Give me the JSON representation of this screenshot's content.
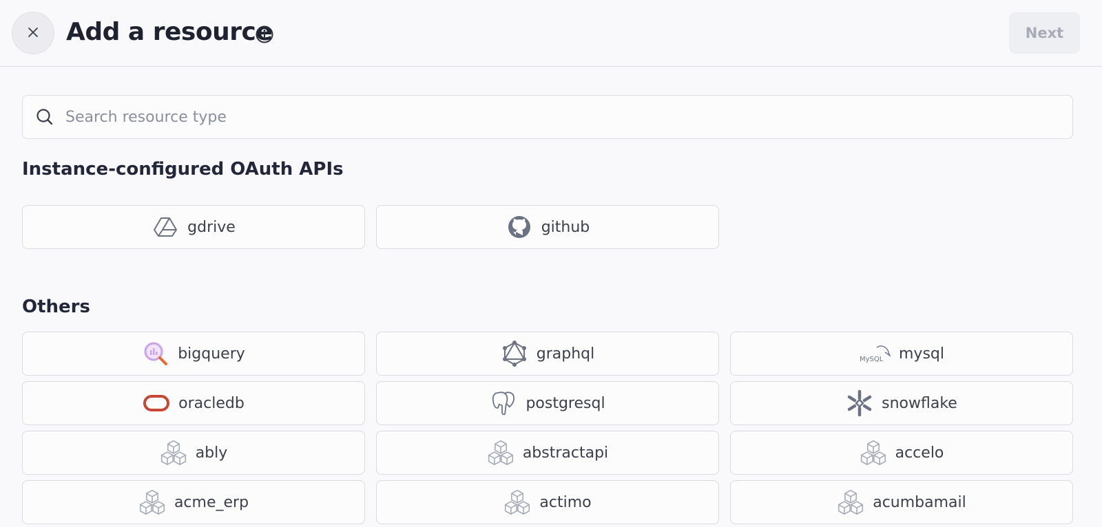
{
  "header": {
    "title": "Add a resource",
    "next_label": "Next"
  },
  "search": {
    "placeholder": "Search resource type",
    "value": ""
  },
  "sections": {
    "oauth": {
      "title": "Instance-configured OAuth APIs",
      "items": [
        {
          "label": "gdrive",
          "icon": "google-drive-icon"
        },
        {
          "label": "github",
          "icon": "github-icon"
        }
      ]
    },
    "others": {
      "title": "Others",
      "items": [
        {
          "label": "bigquery",
          "icon": "bigquery-icon"
        },
        {
          "label": "graphql",
          "icon": "graphql-icon"
        },
        {
          "label": "mysql",
          "icon": "mysql-icon"
        },
        {
          "label": "oracledb",
          "icon": "oracle-icon"
        },
        {
          "label": "postgresql",
          "icon": "postgresql-icon"
        },
        {
          "label": "snowflake",
          "icon": "snowflake-icon"
        },
        {
          "label": "ably",
          "icon": "cubes-icon"
        },
        {
          "label": "abstractapi",
          "icon": "cubes-icon"
        },
        {
          "label": "accelo",
          "icon": "cubes-icon"
        },
        {
          "label": "acme_erp",
          "icon": "cubes-icon"
        },
        {
          "label": "actimo",
          "icon": "cubes-icon"
        },
        {
          "label": "acumbamail",
          "icon": "cubes-icon"
        }
      ]
    }
  },
  "colors": {
    "oracle": "#c74634",
    "bigquery_purple": "#c9a4e8",
    "bigquery_orange": "#e8692e",
    "icon_gray": "#6b7383"
  }
}
